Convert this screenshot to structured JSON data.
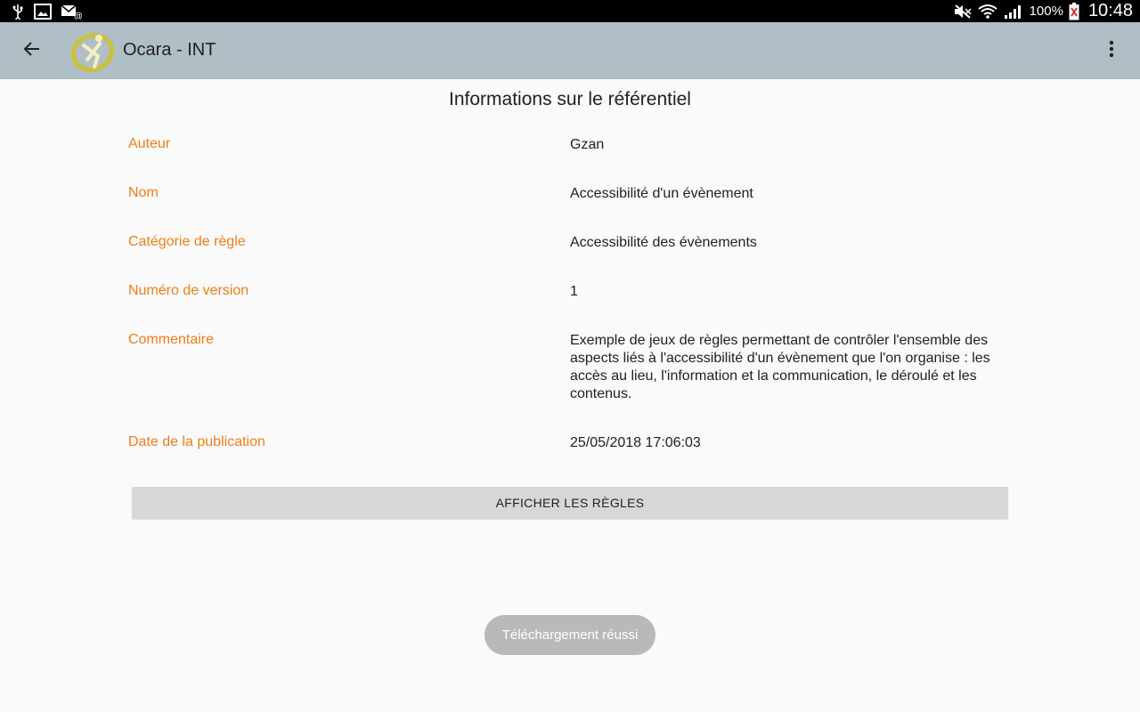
{
  "status_bar": {
    "battery_percent": "100%",
    "time": "10:48",
    "left_icons": [
      "usb-icon",
      "image-icon",
      "email-icon"
    ],
    "right_icons": [
      "mute-icon",
      "wifi-icon",
      "signal-icon",
      "battery-icon"
    ]
  },
  "app_bar": {
    "title": "Ocara - INT",
    "background": "#b0bec5"
  },
  "page": {
    "title": "Informations sur le référentiel",
    "fields": [
      {
        "label": "Auteur",
        "value": "Gzan"
      },
      {
        "label": "Nom",
        "value": "Accessibilité d'un évènement"
      },
      {
        "label": "Catégorie de règle",
        "value": "Accessibilité des évènements"
      },
      {
        "label": "Numéro de version",
        "value": "1"
      },
      {
        "label": "Commentaire",
        "value": "Exemple de jeux de règles permettant de contrôler l'ensemble des aspects liés à l'accessibilité d'un évènement que l'on organise : les accès au lieu, l'information et la communication, le déroulé et les contenus."
      },
      {
        "label": "Date de la publication",
        "value": "25/05/2018 17:06:03"
      }
    ],
    "label_color": "#ef7d16",
    "show_rules_button": "AFFICHER LES RÈGLES"
  },
  "toast": {
    "message": "Téléchargement réussi"
  }
}
